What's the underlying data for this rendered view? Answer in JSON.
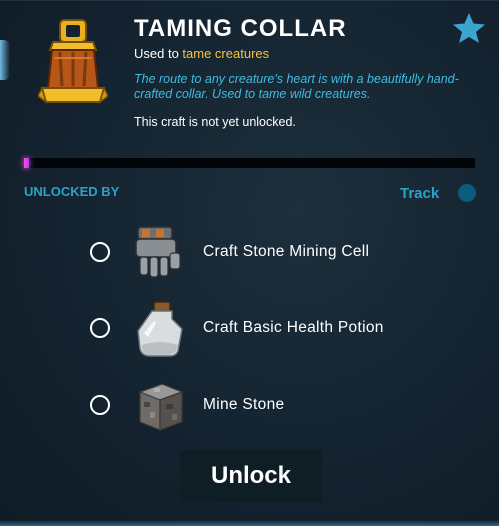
{
  "item": {
    "title": "TAMING COLLAR",
    "used_to_prefix": "Used to ",
    "used_to_target": "tame creatures",
    "description": "The route to any creature's heart is with a beautifully hand-crafted collar. Used to tame wild creatures.",
    "lock_status": "This craft is not yet unlocked.",
    "icon": "taming-collar-icon"
  },
  "progress": {
    "fraction": 0.01,
    "color": "#e65cff"
  },
  "unlocked_by": {
    "heading": "UNLOCKED BY",
    "track_label": "Track",
    "requirements": [
      {
        "label": "Craft Stone Mining Cell",
        "icon": "stone-mining-cell-icon",
        "checked": false
      },
      {
        "label": "Craft Basic Health Potion",
        "icon": "health-potion-icon",
        "checked": false
      },
      {
        "label": "Mine Stone",
        "icon": "stone-block-icon",
        "checked": false
      }
    ]
  },
  "actions": {
    "unlock_label": "Unlock"
  },
  "colors": {
    "accent_blue": "#2aa3c8",
    "highlight_yellow": "#f2c53d",
    "star": "#3aa6d0"
  }
}
